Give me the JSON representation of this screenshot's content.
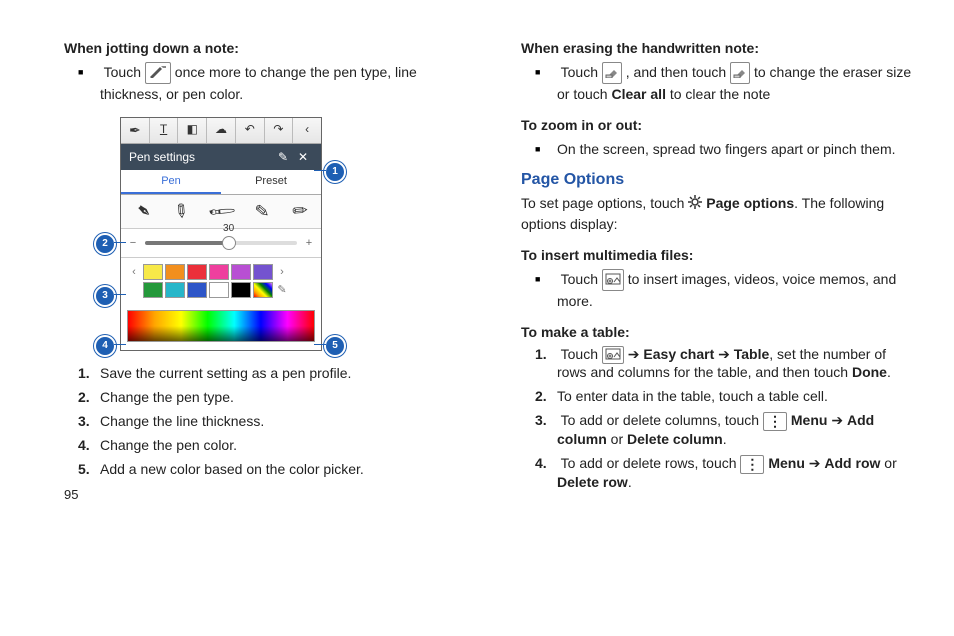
{
  "left": {
    "heading": "When jotting down a note:",
    "bullet": {
      "pre": "Touch ",
      "post": " once more to change the pen type, line thickness, or pen color."
    },
    "figure": {
      "title": "Pen settings",
      "tab1": "Pen",
      "tab2": "Preset",
      "slider_value": "30",
      "swatches_top": [
        "#f7e948",
        "#f28f1e",
        "#eb2f3a",
        "#ef3f9e",
        "#b84fd3",
        "#7453cf"
      ],
      "swatches_bot": [
        "#24983a",
        "#27b6c9",
        "#2e56c8",
        "#ffffff",
        "#000000",
        "rainbow"
      ]
    },
    "list": [
      "Save the current setting as a pen profile.",
      "Change the pen type.",
      "Change the line thickness.",
      "Change the pen color.",
      "Add a new color based on the color picker."
    ],
    "page_number": "95"
  },
  "right": {
    "heading1": "When erasing the handwritten note:",
    "bullet1": {
      "a": "Touch ",
      "b": ", and then touch ",
      "c": " to change the eraser size or touch ",
      "clear_all": "Clear all",
      "d": " to clear the note"
    },
    "heading2": "To zoom in or out:",
    "bullet2": "On the screen, spread two fingers apart or pinch them.",
    "section_title": "Page Options",
    "po_para": {
      "a": "To set page options, touch ",
      "b": " Page options",
      "c": ". The following options display:"
    },
    "heading3": "To insert multimedia files:",
    "bullet3": {
      "a": "Touch ",
      "b": " to insert images, videos, voice memos, and more."
    },
    "heading4": "To make a table:",
    "table_list": {
      "1": {
        "a": "Touch ",
        "b": " ➔ ",
        "easy_chart": "Easy chart",
        "arrow": " ➔ ",
        "table": "Table",
        "c": ", set the number of rows and columns for the table, and then touch ",
        "done": "Done",
        "d": "."
      },
      "2": "To enter data in the table, touch a table cell.",
      "3": {
        "a": "To add or delete columns, touch ",
        "menu": " Menu",
        "arrow": " ➔ ",
        "add_col": "Add column",
        "or": " or ",
        "del_col": "Delete column",
        "d": "."
      },
      "4": {
        "a": "To add or delete rows, touch ",
        "menu": " Menu",
        "arrow": " ➔ ",
        "add_row": "Add row",
        "or": " or ",
        "del_row": "Delete row",
        "d": "."
      }
    }
  },
  "icons": {
    "pen_tool": "✎",
    "eraser": "◧",
    "gear": "✲",
    "insert": "⊕",
    "menu": "⋮"
  }
}
